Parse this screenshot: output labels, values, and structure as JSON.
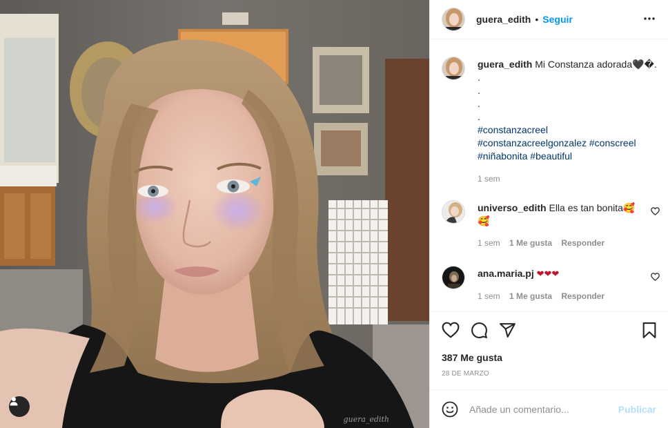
{
  "post": {
    "username": "guera_edith",
    "separator": "•",
    "follow_label": "Seguir",
    "watermark": "guera_edith"
  },
  "caption": {
    "username": "guera_edith",
    "text": "Mi Constanza adorada🖤�.",
    "dots": [
      ".",
      ".",
      ".",
      "."
    ],
    "hashtags_line1": "#constanzacreel",
    "hashtags_line2a": "#constanzacreelgonzalez",
    "hashtags_line2b": "#conscreel",
    "hashtags_line3a": "#niñabonita",
    "hashtags_line3b": "#beautiful",
    "time": "1 sem"
  },
  "comments": [
    {
      "username": "universo_edith",
      "text": "Ella es tan bonita🥰",
      "text2": "🥰",
      "time": "1 sem",
      "likes_label": "1 Me gusta",
      "reply_label": "Responder"
    },
    {
      "username": "ana.maria.pj",
      "text": "❤❤❤",
      "time": "1 sem",
      "likes_label": "1 Me gusta",
      "reply_label": "Responder"
    }
  ],
  "stats": {
    "likes": "387 Me gusta",
    "date": "28 DE MARZO"
  },
  "add_comment": {
    "placeholder": "Añade un comentario...",
    "publish_label": "Publicar"
  },
  "icons": {
    "more": "more-options-icon",
    "like": "heart-icon",
    "comment": "comment-bubble-icon",
    "share": "paper-plane-icon",
    "save": "bookmark-icon",
    "emoji": "emoji-icon",
    "tag": "user-tag-icon"
  },
  "colors": {
    "link_blue": "#0095f6",
    "hashtag": "#00376b",
    "muted": "#8e8e8e",
    "publish_disabled": "#b2dffc",
    "heart_red": "#c0152f"
  }
}
